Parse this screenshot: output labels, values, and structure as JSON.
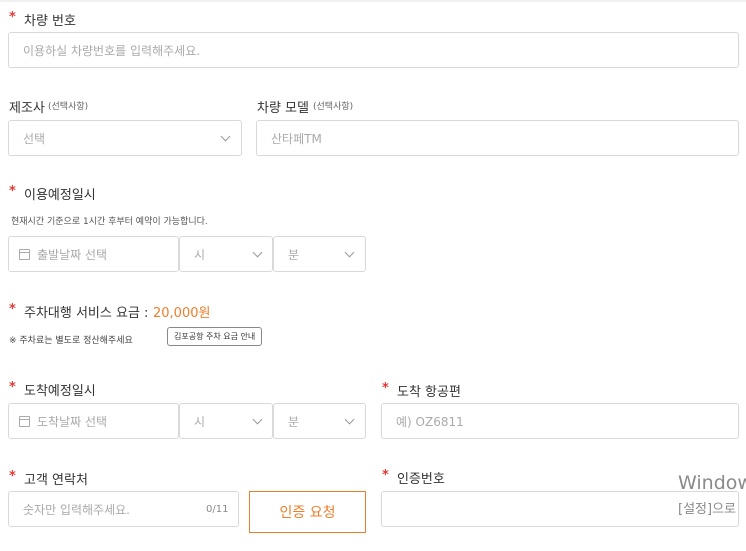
{
  "vehicle_number": {
    "required_mark": "*",
    "label": "차량 번호",
    "placeholder": "이용하실 차량번호를 입력해주세요."
  },
  "manufacturer": {
    "label": "제조사",
    "optional": "(선택사항)",
    "selected": "선택"
  },
  "vehicle_model": {
    "label": "차량 모델",
    "optional": "(선택사항)",
    "placeholder": "산타페TM"
  },
  "usage_schedule": {
    "required_mark": "*",
    "label": "이용예정일시",
    "hint": "현재시간 기준으로 1시간 후부터 예약이 가능합니다.",
    "date_placeholder": "출발날짜 선택",
    "hour_placeholder": "시",
    "minute_placeholder": "분"
  },
  "valet_fee": {
    "required_mark": "*",
    "label": "주차대행 서비스 요금 :",
    "amount": "20,000원",
    "note": "※ 주차료는 별도로 정산해주세요",
    "guide_button": "김포공항 주차 요금 안내"
  },
  "arrival_schedule": {
    "required_mark": "*",
    "label": "도착예정일시",
    "date_placeholder": "도착날짜 선택",
    "hour_placeholder": "시",
    "minute_placeholder": "분"
  },
  "arrival_flight": {
    "required_mark": "*",
    "label": "도착 항공편",
    "placeholder": "예) OZ6811"
  },
  "customer_contact": {
    "required_mark": "*",
    "label": "고객 연락처",
    "placeholder": "숫자만 입력해주세요.",
    "counter": "0/11",
    "verify_button": "인증 요청"
  },
  "verification_code": {
    "required_mark": "*",
    "label": "인증번호"
  },
  "watermark": {
    "line1": "Window",
    "line2": "[설정]으로"
  },
  "colors": {
    "accent": "#f07d2a",
    "required": "#e53935",
    "border": "#d9d9d9"
  }
}
